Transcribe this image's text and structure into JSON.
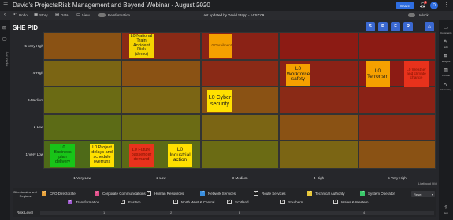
{
  "topbar": {
    "workspace": "David's Projects",
    "separator": "›",
    "report_title": "Risk Management and Beyond Webinar - August 2020",
    "version_tag": "Version 1",
    "share_label": "Share",
    "notification_count": "4",
    "avatar_initial": "D"
  },
  "toolbar": {
    "undo_label": "Undo",
    "story_label": "Story",
    "data_label": "Data",
    "view_label": "View",
    "reinformation_label": "Reinformation",
    "last_updated": "Last updated by David Stapp - 14:57:09",
    "unlock_label": "Unlock"
  },
  "page": {
    "title": "SHE PID"
  },
  "view_buttons": [
    "S",
    "P",
    "F",
    "R"
  ],
  "matrix": {
    "y_axis_title": "Impact (9/4)",
    "x_axis_title": "Likelihood (9/4)",
    "rows": [
      "5-Very High",
      "4-High",
      "3-Medium",
      "2-Low",
      "1-Very Low"
    ],
    "columns": [
      "1-Very Low",
      "2-Low",
      "3-Medium",
      "4-High",
      "5-Very High"
    ],
    "cell_colors": [
      [
        "#8a5214",
        "#8a2a16",
        "#8a2216",
        "#8c1b14",
        "#8c1b14"
      ],
      [
        "#7b6514",
        "#8a5214",
        "#8a2a16",
        "#8a2216",
        "#8c1b14"
      ],
      [
        "#6b6b14",
        "#7b6514",
        "#8a5214",
        "#8a2a16",
        "#8a2216"
      ],
      [
        "#5c6b16",
        "#6b6b14",
        "#7b6514",
        "#8a5214",
        "#8a2a16"
      ],
      [
        "#4e6a18",
        "#5c6b16",
        "#6b6b14",
        "#7b6514",
        "#8a5214"
      ]
    ]
  },
  "risks": [
    {
      "text": "L0 National Train Accident Risk (demo)",
      "color": "#f5d400",
      "text_color": "#1a1a1a"
    },
    {
      "text": "L0 Derailment",
      "color": "#f5a000",
      "text_color": "#6b3a00"
    },
    {
      "text": "L0 Workforce safety",
      "color": "#f5a000",
      "text_color": "#1a1a1a"
    },
    {
      "text": "L0 Terrorism",
      "color": "#f5a000",
      "text_color": "#1a1a1a"
    },
    {
      "text": "L0 Weather and climate change",
      "color": "#e8321c",
      "text_color": "#7a1200"
    },
    {
      "text": "L0 Cyber security",
      "color": "#ffe000",
      "text_color": "#1a1a1a"
    },
    {
      "text": "L0 Business plan delivery",
      "color": "#18c418",
      "text_color": "#0b3a0b"
    },
    {
      "text": "L0 Project delays and schedule overruns",
      "color": "#ffe000",
      "text_color": "#1a1a1a"
    },
    {
      "text": "L0 Future passenger demand",
      "color": "#e8321c",
      "text_color": "#7a1200"
    },
    {
      "text": "L0 Industrial action",
      "color": "#ffe000",
      "text_color": "#1a1a1a"
    }
  ],
  "filters": {
    "group_label": "Directorates and Regions",
    "risk_level_label": "Risk Level",
    "reset_label": "Reset",
    "row1": [
      {
        "label": "CFO Directorate",
        "checked": true,
        "swatch": "#e8a23a"
      },
      {
        "label": "Corporate Communications",
        "checked": true,
        "swatch": "#e04f8a"
      },
      {
        "label": "Human Resources",
        "checked": true,
        "swatch": "#d0d0d0"
      },
      {
        "label": "Network Services",
        "checked": true,
        "swatch": "#3a8fe0"
      },
      {
        "label": "Route Services",
        "checked": true,
        "swatch": "#d0d0d0"
      },
      {
        "label": "Technical Authority",
        "checked": true,
        "swatch": "#e8c83a"
      },
      {
        "label": "System Operator",
        "checked": true,
        "swatch": "#3ac86a"
      }
    ],
    "row2": [
      {
        "label": "Transformation",
        "checked": true,
        "swatch": "#a05ad0"
      },
      {
        "label": "Eastern",
        "checked": true,
        "swatch": "#d0d0d0"
      },
      {
        "label": "North West & Central",
        "checked": true,
        "swatch": "#d0d0d0"
      },
      {
        "label": "Scotland",
        "checked": true,
        "swatch": "#d0d0d0"
      },
      {
        "label": "Southern",
        "checked": true,
        "swatch": "#d0d0d0"
      },
      {
        "label": "Wales & Western",
        "checked": true,
        "swatch": "#d0d0d0"
      }
    ],
    "risk_levels": [
      "1",
      "2",
      "3",
      "4"
    ]
  },
  "right_rail": [
    "Comments",
    "Edit",
    "Widgets",
    "Format",
    "Interacting",
    "Help"
  ]
}
